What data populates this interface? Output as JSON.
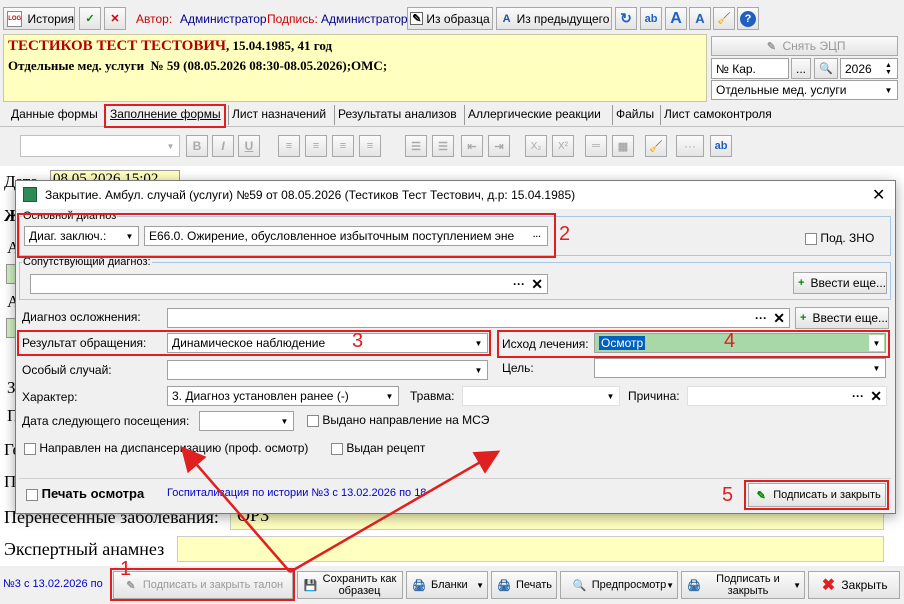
{
  "toolbar": {
    "history": "История",
    "author_label": "Автор:",
    "author": "Администратор",
    "signature_label": "Подпись:",
    "signer": "Администратор",
    "from_template": "Из образца",
    "from_previous": "Из предыдущего"
  },
  "patient": {
    "name": "ТЕСТИКОВ ТЕСТ ТЕСТОВИЧ",
    "info": ", 15.04.1985, 41 год",
    "service": "Отдельные мед. услуги  № 59 (08.05.2026 08:30-08.05.2026);ОМС;"
  },
  "right_panel": {
    "remove_ecp": "Снять ЭЦП",
    "card_label": "№ Кар.",
    "year": "2026",
    "service_type": "Отдельные мед. услуги"
  },
  "tabs": [
    "Данные формы",
    "Заполнение формы",
    "Лист назначений",
    "Результаты анализов",
    "Аллергические реакции",
    "Файлы",
    "Лист самоконтроля"
  ],
  "background_form": {
    "date_label": "Дата",
    "date_value": "08.05.2026 15:02",
    "diseases_label": "Перенесенные заболевания:",
    "diseases_value": "ОРЗ",
    "expert_label": "Экспертный анамнез",
    "hosp_link": "№3 с 13.02.2026 по"
  },
  "dialog": {
    "title": "Закрытие. Амбул. случай (услуги) №59 от 08.05.2026 (Тестиков Тест Тестович, д.р: 15.04.1985)",
    "main_diag_group": "Основной диагноз",
    "diag_type": "Диаг. заключ.:",
    "main_diag": "E66.0. Ожирение, обусловленное избыточным поступлением эне",
    "zno": "Под. ЗНО",
    "concomitant_group": "Сопутствующий диагноз:",
    "enter_more": "Ввести еще...",
    "complication_label": "Диагноз осложнения:",
    "result_label": "Результат обращения:",
    "result_value": "Динамическое наблюдение",
    "outcome_label": "Исход лечения:",
    "outcome_value": "Осмотр",
    "special_case_label": "Особый случай:",
    "goal_label": "Цель:",
    "character_label": "Характер:",
    "character_value": "3. Диагноз установлен ранее (-)",
    "trauma_label": "Травма:",
    "reason_label": "Причина:",
    "next_visit_label": "Дата следующего посещения:",
    "mse_label": "Выдано направление на МСЭ",
    "dispensary_label": "Направлен на диспансеризацию (проф. осмотр)",
    "recipe_label": "Выдан рецепт",
    "print_exam": "Печать осмотра",
    "hosp_link": "Госпитализация по истории №3 с 13.02.2026 по 18",
    "sign_close": "Подписать и закрыть"
  },
  "bottom": {
    "sign_close_coupon": "Подписать и закрыть талон",
    "save_template": "Сохранить как образец",
    "blanks": "Бланки",
    "print": "Печать",
    "preview": "Предпросмотр",
    "sign_close": "Подписать и закрыть",
    "close": "Закрыть"
  },
  "annotations": [
    "1",
    "2",
    "3",
    "4",
    "5"
  ],
  "colors": {
    "yellow": "#ffffc0",
    "selection": "#a8d8a8",
    "red_marker": "#e02020",
    "link": "#0000c8"
  }
}
